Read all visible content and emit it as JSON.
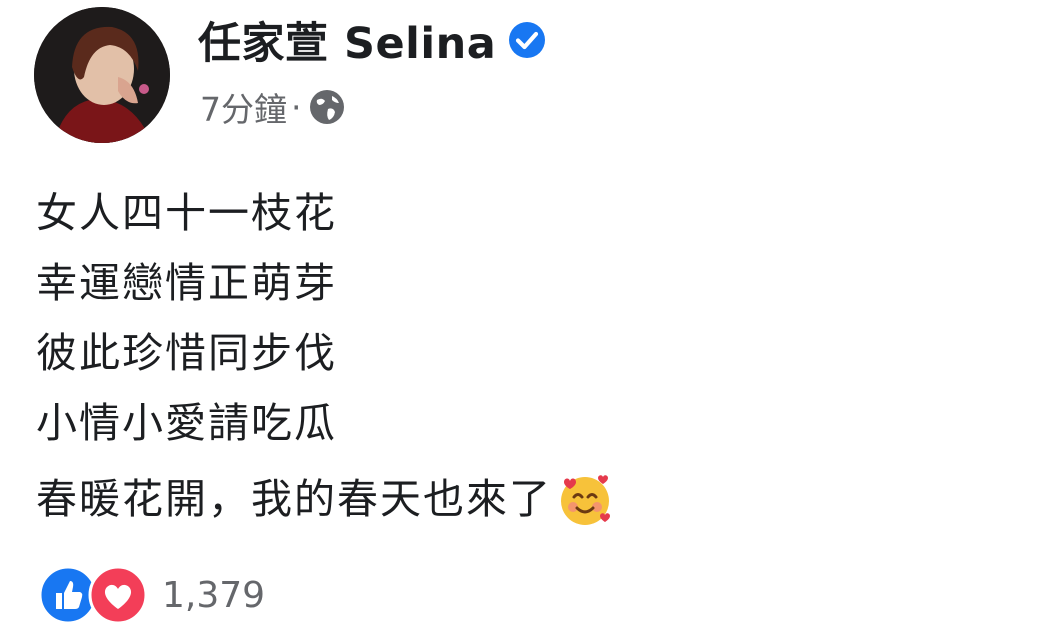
{
  "post": {
    "author": "任家萱 Selina",
    "verified_icon": "verified-badge-icon",
    "time": "7分鐘",
    "separator": "·",
    "audience_icon": "globe-icon",
    "text_lines": [
      "女人四十一枝花",
      "幸運戀情正萌芽",
      "彼此珍惜同步伐",
      "小情小愛請吃瓜"
    ],
    "text_line2": "春暖花開，我的春天也來了",
    "emoji_icon": "smiling-face-with-hearts-icon",
    "reactions": {
      "icons": [
        "like-icon",
        "love-icon"
      ],
      "count": "1,379"
    }
  },
  "colors": {
    "verified": "#1877f2",
    "meta": "#65676b",
    "like": "#1877f2",
    "love": "#f33e58"
  }
}
